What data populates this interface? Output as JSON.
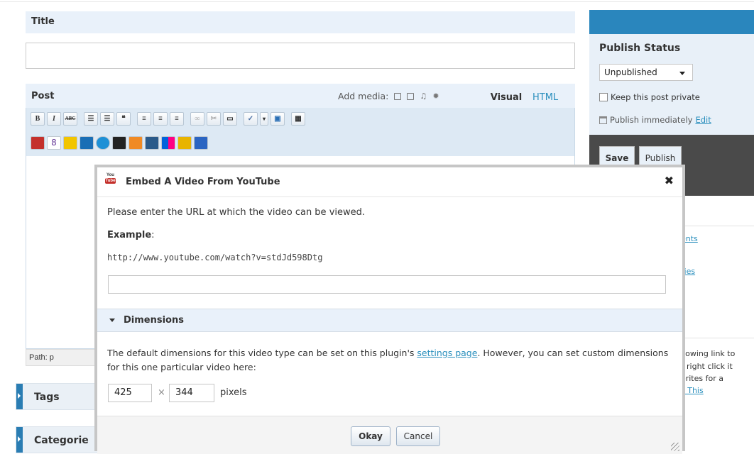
{
  "title_section": {
    "label": "Title",
    "value": ""
  },
  "post": {
    "label": "Post",
    "add_media_label": "Add media:",
    "tabs": [
      "Visual",
      "HTML"
    ],
    "path_label": "Path: p"
  },
  "toolbar": {
    "row1": [
      "B",
      "I",
      "ABC"
    ]
  },
  "metaboxes": [
    "Tags",
    "Categorie"
  ],
  "publish": {
    "title": "Publish Status",
    "status_value": "Unpublished",
    "private_label": "Keep this post private",
    "immediately_label": "Publish immediately",
    "edit_link": "Edit",
    "save_label": "Save",
    "publish_label": "Publish"
  },
  "sidebar_fragments": {
    "link1": "ents",
    "link2": "ries",
    "text1": "llowing link to",
    "text2": "r right click it",
    "text3": "orites for a",
    "link3": "s This"
  },
  "dialog": {
    "title": "Embed A Video From YouTube",
    "close": "✖",
    "instructions": "Please enter the URL at which the video can be viewed.",
    "example_label": "Example",
    "example_colon": ":",
    "example_url": "http://www.youtube.com/watch?v=stdJd598Dtg",
    "url_value": "",
    "dimensions_label": "Dimensions",
    "dimensions_text_before": "The default dimensions for this video type can be set on this plugin's ",
    "settings_link": "settings page",
    "dimensions_text_after": ". However, you can set custom dimensions for this one particular video here:",
    "width": "425",
    "times": "×",
    "height": "344",
    "unit": "pixels",
    "okay_label": "Okay",
    "cancel_label": "Cancel"
  },
  "colors": {
    "accent_blue": "#2a86bd",
    "link_blue": "#2a8fbd",
    "panel_light": "#e9f1fa",
    "sidebar_dark": "#4a4a4a",
    "youtube_red": "#c4302b"
  }
}
